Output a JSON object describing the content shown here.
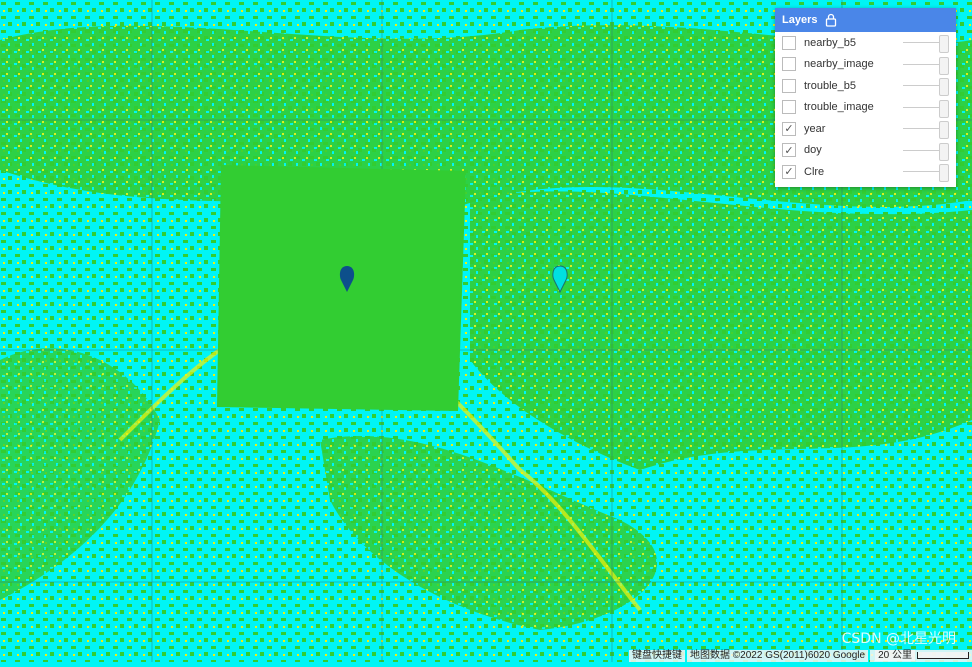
{
  "map": {
    "colors": {
      "water": "#00f5f5",
      "land": "#32cd32",
      "highlight": "#f2f20a",
      "grid": "#2a7a7a"
    },
    "markers": [
      {
        "name": "dark-marker",
        "color": "#0d4f8b"
      },
      {
        "name": "cyan-marker",
        "color": "#00e0e0"
      }
    ]
  },
  "layers_panel": {
    "title": "Layers",
    "items": [
      {
        "label": "nearby_b5",
        "checked": false
      },
      {
        "label": "nearby_image",
        "checked": false
      },
      {
        "label": "trouble_b5",
        "checked": false
      },
      {
        "label": "trouble_image",
        "checked": false
      },
      {
        "label": "year",
        "checked": true
      },
      {
        "label": "doy",
        "checked": true
      },
      {
        "label": "Clre",
        "checked": true
      }
    ]
  },
  "footer": {
    "shortcuts": "键盘快捷键",
    "map_data": "地图数据 ©2022 GS(2011)6020 Google",
    "scale": "20 公里"
  },
  "watermark": "CSDN @北星光明"
}
